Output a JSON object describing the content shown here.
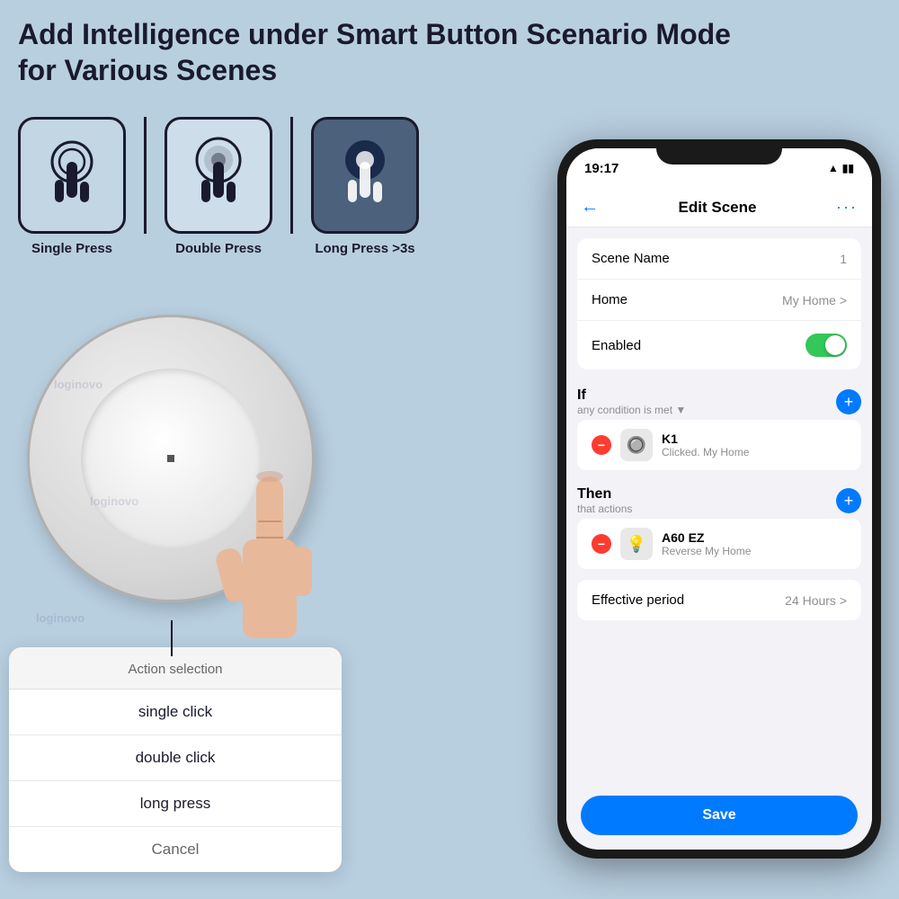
{
  "page": {
    "title": "Add Intelligence under Smart Button Scenario Mode\nfor Various Scenes",
    "background_color": "#b8cfe0"
  },
  "press_types": [
    {
      "id": "single",
      "label": "Single Press"
    },
    {
      "id": "double",
      "label": "Double Press"
    },
    {
      "id": "long",
      "label": "Long Press >3s"
    }
  ],
  "action_popup": {
    "header": "Action selection",
    "items": [
      {
        "id": "single-click",
        "label": "single click"
      },
      {
        "id": "double-click",
        "label": "double click"
      },
      {
        "id": "long-press",
        "label": "long press"
      }
    ],
    "cancel_label": "Cancel"
  },
  "phone": {
    "status_bar": {
      "time": "19:17",
      "icons": "▲ 🔋"
    },
    "header": {
      "back_icon": "←",
      "title": "Edit Scene",
      "more_icon": "···"
    },
    "scene_name_label": "Scene Name",
    "scene_name_value": "1",
    "home_label": "Home",
    "home_value": "My Home >",
    "enabled_label": "Enabled",
    "if_section": {
      "label": "If",
      "sub": "any condition is met ▼"
    },
    "if_items": [
      {
        "name": "K1",
        "sub1": "Clicked.",
        "sub2": "My Home"
      }
    ],
    "then_section": {
      "label": "Then",
      "sub": "that actions"
    },
    "then_items": [
      {
        "name": "A60 EZ",
        "sub1": "Reverse",
        "sub2": "My Home"
      }
    ],
    "effective_period_label": "Effective period",
    "effective_period_value": "24 Hours >",
    "save_label": "Save"
  }
}
